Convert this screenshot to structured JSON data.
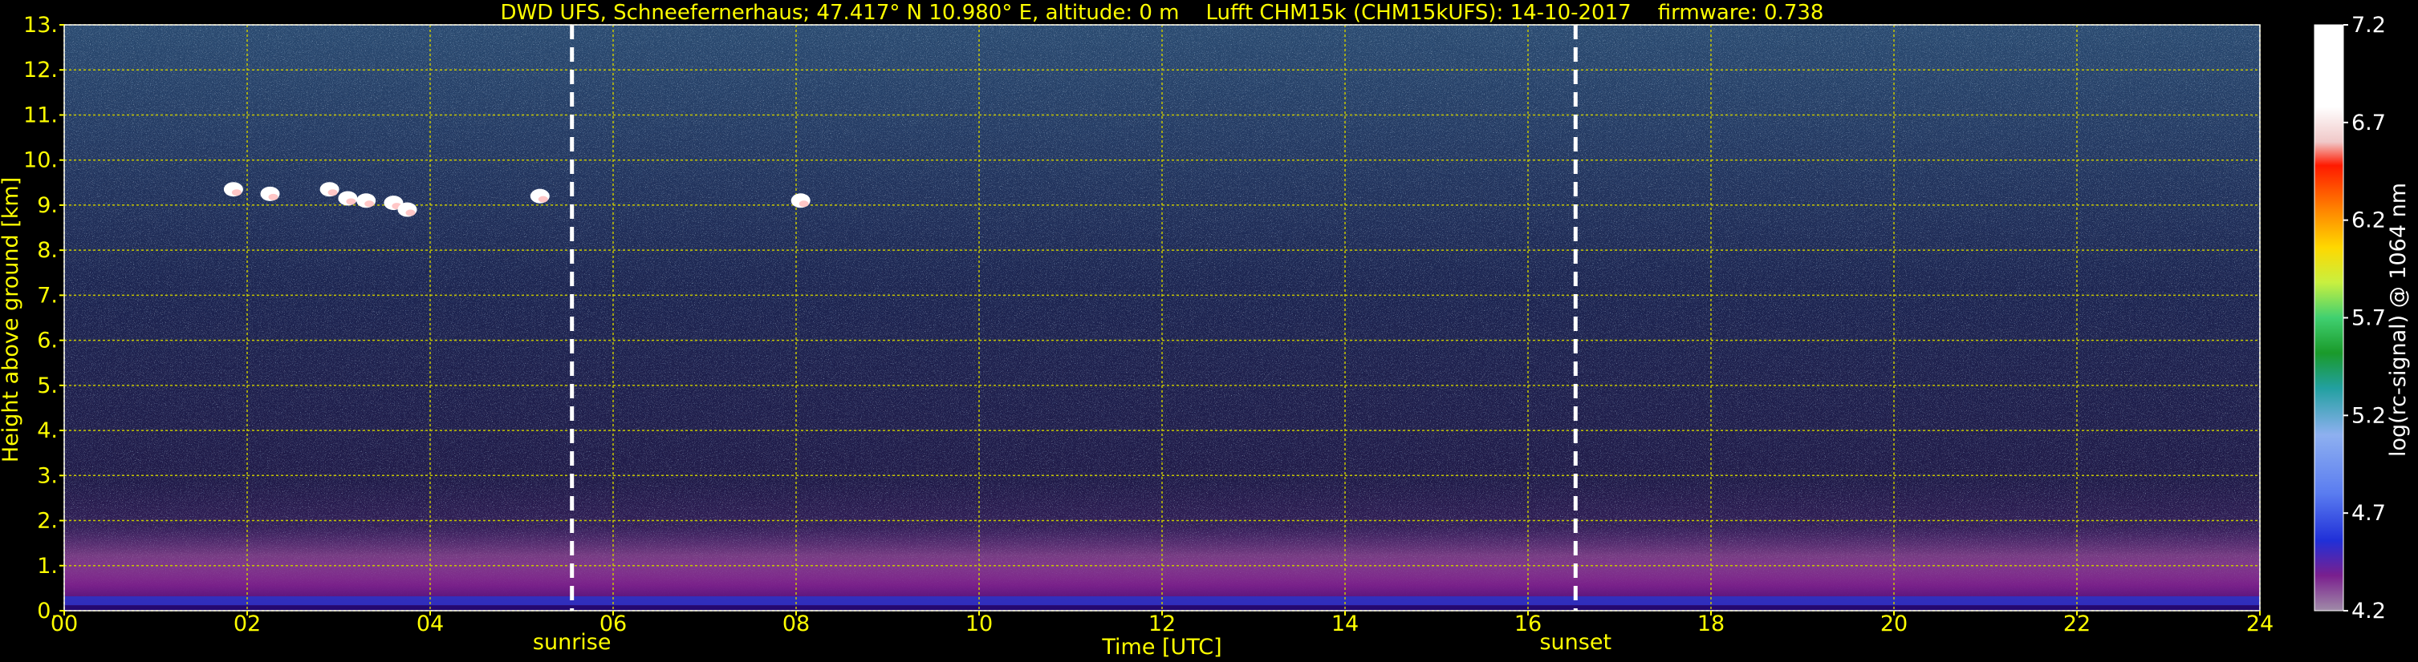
{
  "chart_data": {
    "type": "heatmap",
    "title": "DWD UFS, Schneefernerhaus; 47.417° N 10.980° E, altitude: 0 m    Lufft CHM15k (CHM15kUFS): 14-10-2017    firmware: 0.738",
    "xlabel": "Time [UTC]",
    "ylabel": "Height above ground [km]",
    "x_ticks": [
      "00",
      "02",
      "04",
      "06",
      "08",
      "10",
      "12",
      "14",
      "16",
      "18",
      "20",
      "22",
      "24"
    ],
    "y_ticks": [
      "0.",
      "1.",
      "2.",
      "3.",
      "4.",
      "5.",
      "6.",
      "7.",
      "8.",
      "9.",
      "10.",
      "11.",
      "12.",
      "13."
    ],
    "xlim": [
      0,
      24
    ],
    "ylim": [
      0,
      13
    ],
    "grid": true,
    "events": [
      {
        "label": "sunrise",
        "time": 5.55
      },
      {
        "label": "sunset",
        "time": 16.52
      }
    ],
    "colorbar": {
      "label": "log(rc-signal) @ 1064 nm",
      "range": [
        4.2,
        7.2
      ],
      "ticks": [
        "4.2",
        "4.7",
        "5.2",
        "5.7",
        "6.2",
        "6.7",
        "7.2"
      ]
    },
    "cloud_patches": [
      {
        "time": 1.85,
        "height": 9.35
      },
      {
        "time": 2.25,
        "height": 9.25
      },
      {
        "time": 2.9,
        "height": 9.35
      },
      {
        "time": 3.1,
        "height": 9.15
      },
      {
        "time": 3.3,
        "height": 9.1
      },
      {
        "time": 3.6,
        "height": 9.05
      },
      {
        "time": 3.75,
        "height": 8.9
      },
      {
        "time": 5.2,
        "height": 9.2
      },
      {
        "time": 8.05,
        "height": 9.1
      }
    ]
  },
  "colors": {
    "axis_text": "#ffff00",
    "grid": "#c8c800",
    "background": "#000000",
    "event_line": "#ffffff"
  }
}
